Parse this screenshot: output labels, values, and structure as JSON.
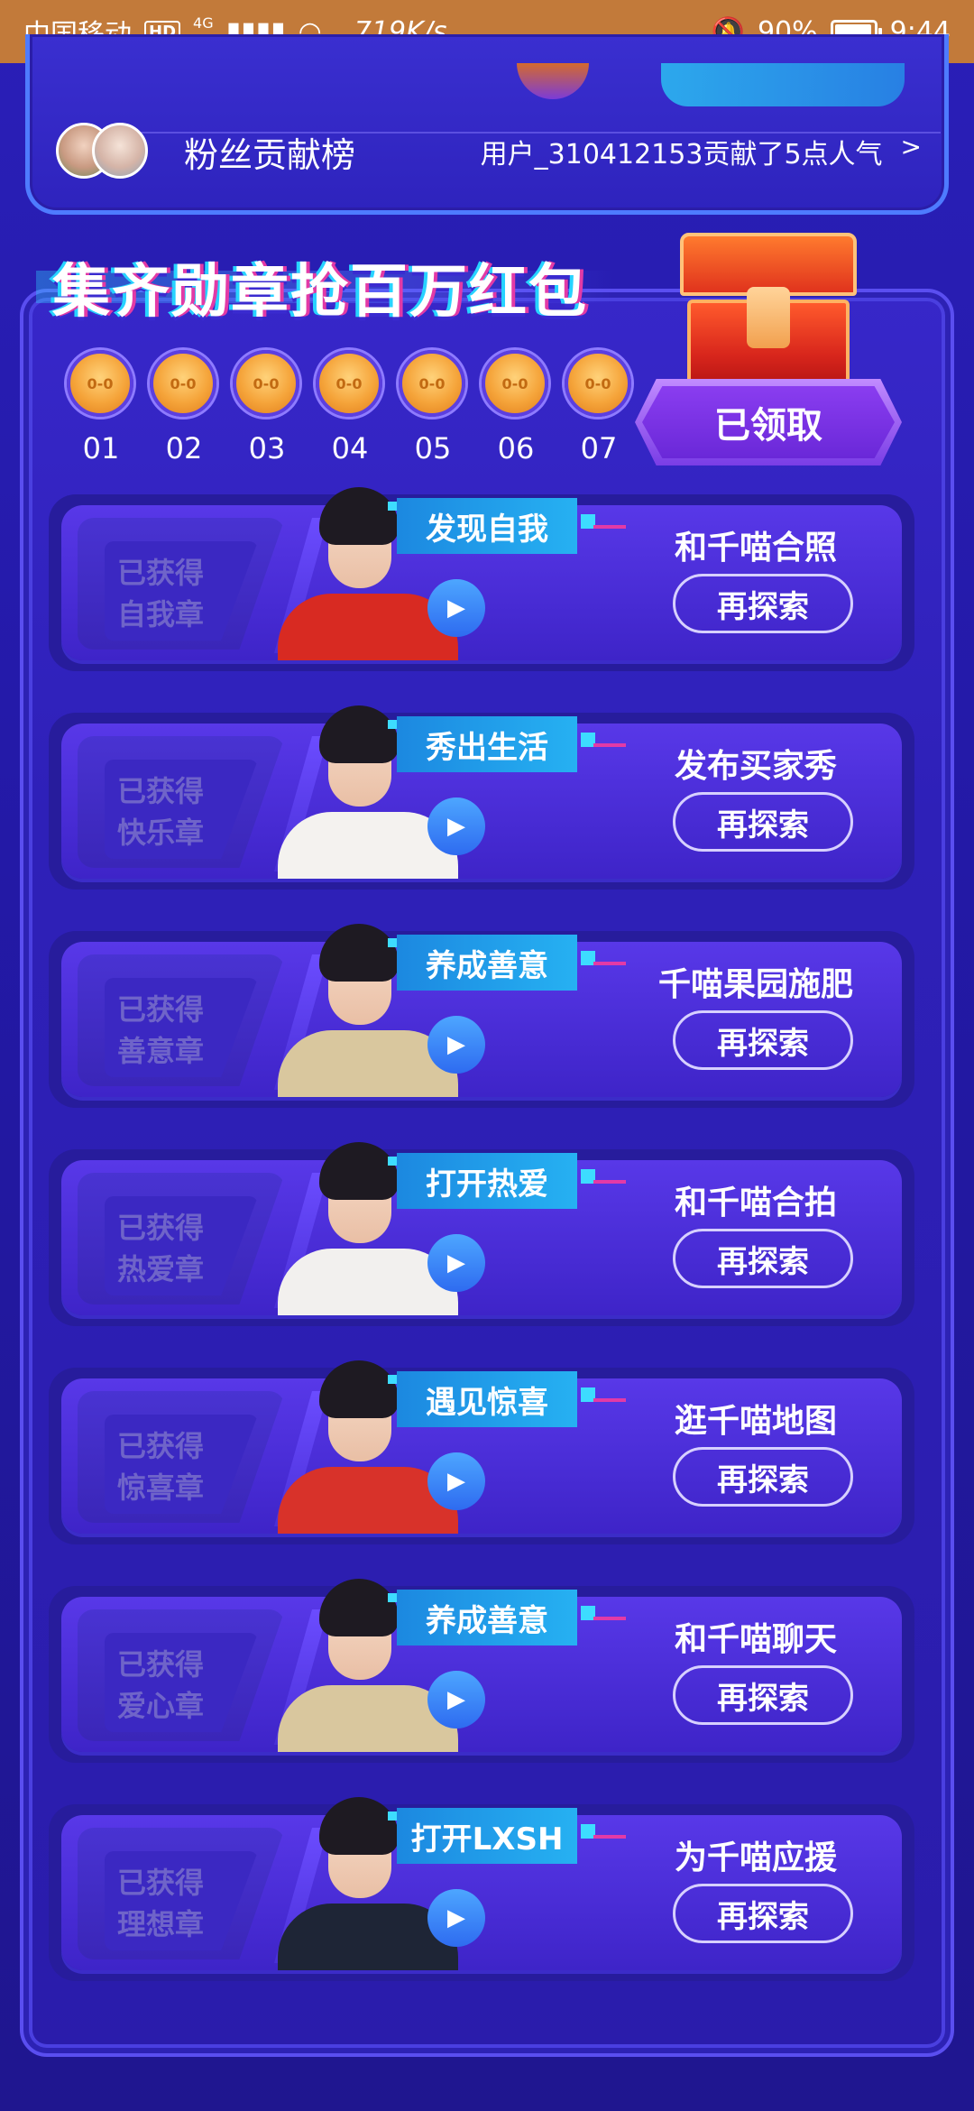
{
  "status_bar": {
    "carrier": "中国移动",
    "hd": "HD",
    "network": "4G",
    "speed": "719K/s",
    "battery": "90%",
    "time": "9:44"
  },
  "fan_board": {
    "title": "粉丝贡献榜",
    "info": "用户_310412153贡献了5点人气",
    "chevron": ">"
  },
  "banner": {
    "title": "集齐勋章抢百万红包",
    "claim_label": "已领取"
  },
  "medals": [
    {
      "label": "01",
      "face": "0-0"
    },
    {
      "label": "02",
      "face": "0-0"
    },
    {
      "label": "03",
      "face": "0-0"
    },
    {
      "label": "04",
      "face": "0-0"
    },
    {
      "label": "05",
      "face": "0-0"
    },
    {
      "label": "06",
      "face": "0-0"
    },
    {
      "label": "07",
      "face": "0-0"
    }
  ],
  "tasks": [
    {
      "badge_line1": "已获得",
      "badge_line2": "自我章",
      "tag": "发现自我",
      "name": "和千喵合照",
      "button": "再探索",
      "outfit": "#d82a22"
    },
    {
      "badge_line1": "已获得",
      "badge_line2": "快乐章",
      "tag": "秀出生活",
      "name": "发布买家秀",
      "button": "再探索",
      "outfit": "#f4f2ef"
    },
    {
      "badge_line1": "已获得",
      "badge_line2": "善意章",
      "tag": "养成善意",
      "name": "千喵果园施肥",
      "button": "再探索",
      "outfit": "#d9c79e"
    },
    {
      "badge_line1": "已获得",
      "badge_line2": "热爱章",
      "tag": "打开热爱",
      "name": "和千喵合拍",
      "button": "再探索",
      "outfit": "#f2f0ee"
    },
    {
      "badge_line1": "已获得",
      "badge_line2": "惊喜章",
      "tag": "遇见惊喜",
      "name": "逛千喵地图",
      "button": "再探索",
      "outfit": "#d8322a"
    },
    {
      "badge_line1": "已获得",
      "badge_line2": "爱心章",
      "tag": "养成善意",
      "name": "和千喵聊天",
      "button": "再探索",
      "outfit": "#d9c79e"
    },
    {
      "badge_line1": "已获得",
      "badge_line2": "理想章",
      "tag": "打开LXSH",
      "name": "为千喵应援",
      "button": "再探索",
      "outfit": "#1e2536"
    }
  ]
}
